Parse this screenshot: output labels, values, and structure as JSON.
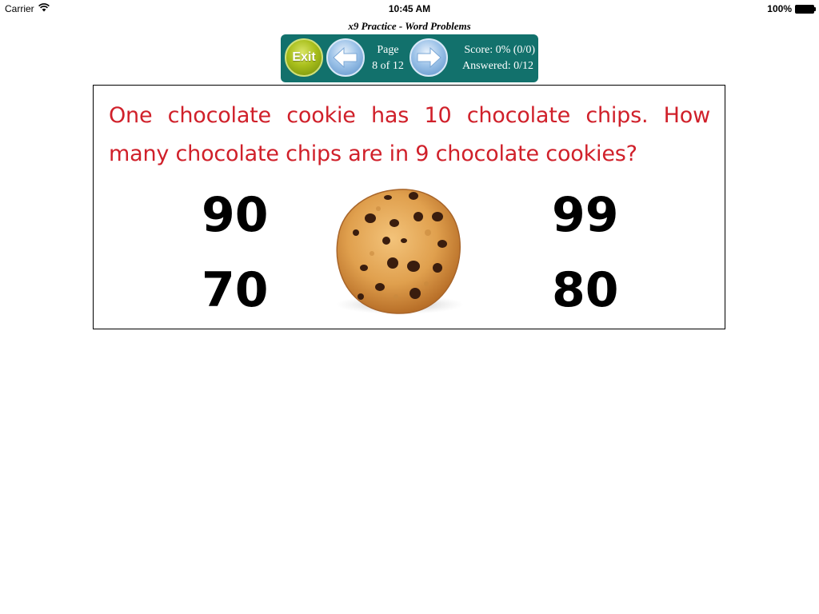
{
  "status_bar": {
    "carrier": "Carrier",
    "time": "10:45 AM",
    "battery": "100%",
    "icons": [
      "wifi-icon",
      "battery-icon"
    ]
  },
  "app": {
    "title": "x9 Practice - Word Problems"
  },
  "toolbar": {
    "exit_label": "Exit",
    "page_label": "Page",
    "page_value": "8 of 12",
    "score_text": "Score: 0% (0/0)",
    "answered_text": "Answered: 0/12",
    "icons": [
      "left-arrow-icon",
      "right-arrow-icon"
    ]
  },
  "question": {
    "text": "One chocolate cookie has 10 chocolate chips. How many chocolate chips are in 9 chocolate cookies?",
    "answers": [
      "90",
      "99",
      "70",
      "80"
    ],
    "image": "chocolate-chip-cookie-image"
  },
  "colors": {
    "toolbar_bg": "#12716c",
    "question_text": "#d0202a",
    "exit_button": "#a9bf1c",
    "arrow_button": "#9cc2e8"
  }
}
